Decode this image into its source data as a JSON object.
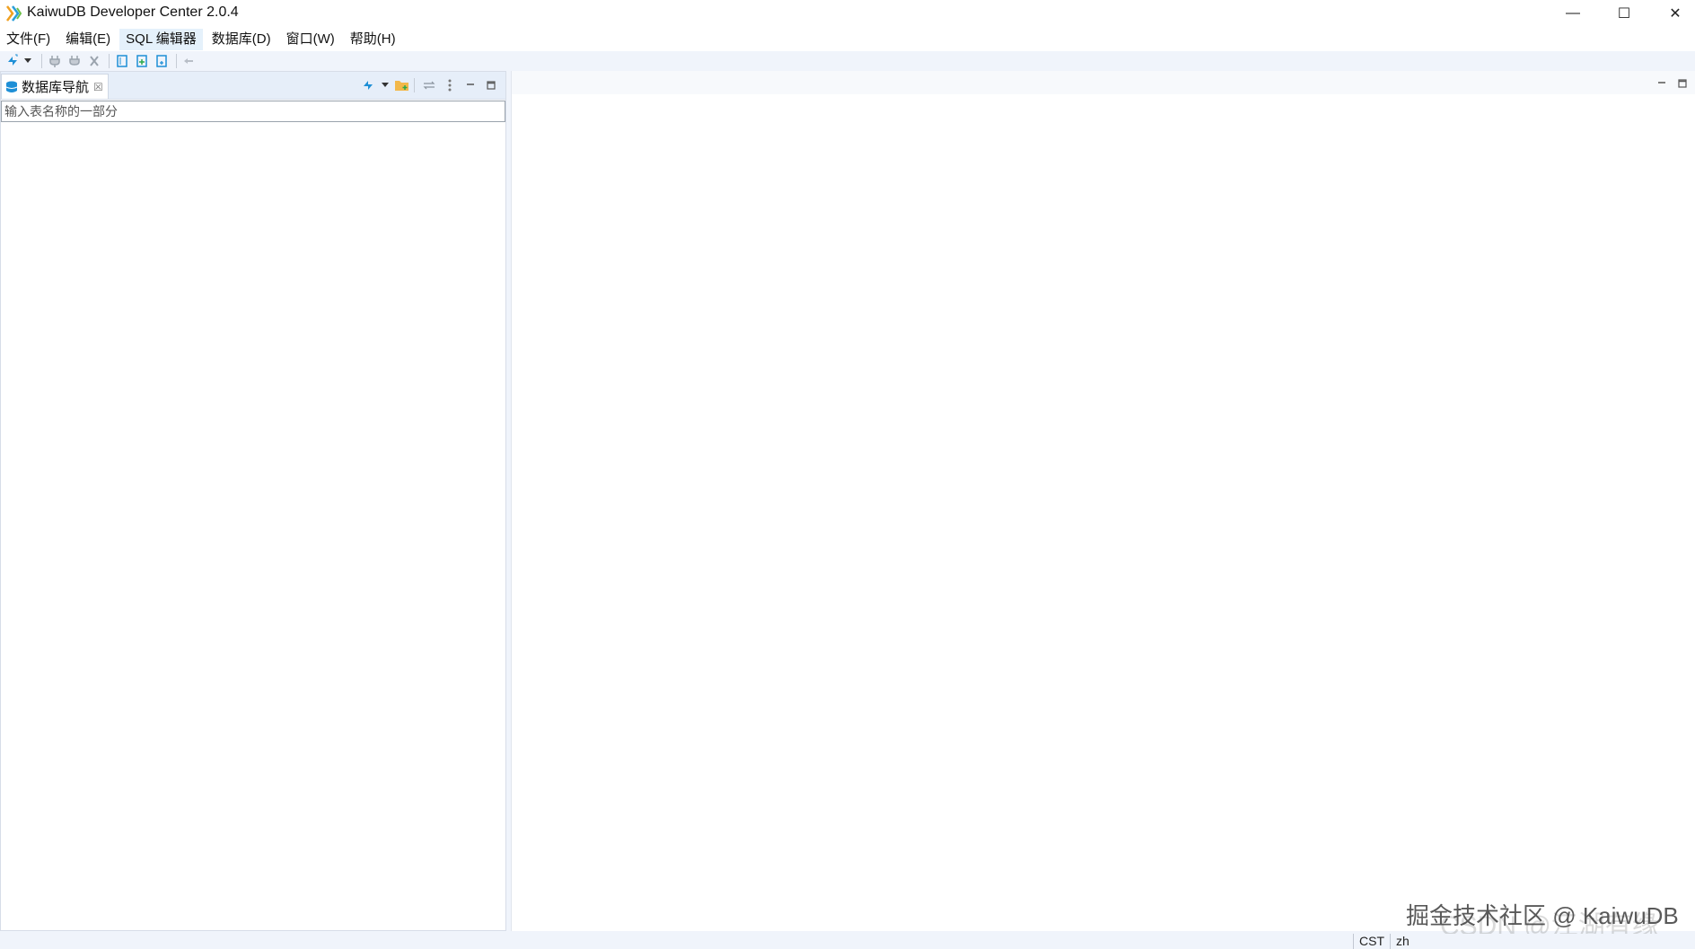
{
  "window": {
    "title": "KaiwuDB Developer Center 2.0.4",
    "controls": {
      "minimize": "—",
      "maximize": "☐",
      "close": "✕"
    }
  },
  "menu": {
    "items": [
      "文件(F)",
      "编辑(E)",
      "SQL 编辑器",
      "数据库(D)",
      "窗口(W)",
      "帮助(H)"
    ],
    "active": "SQL 编辑器"
  },
  "toolbar": {
    "icons": [
      "new-connection-icon",
      "dropdown-arrow-icon",
      "connect-icon",
      "reconnect-icon",
      "disconnect-icon",
      "sql-editor-icon",
      "new-script-icon",
      "recent-script-icon",
      "commit-mode-icon"
    ]
  },
  "navigator": {
    "tab_label": "数据库导航",
    "tab_close": "☒",
    "filter_placeholder": "输入表名称的一部分"
  },
  "statusbar": {
    "timezone": "CST",
    "locale": "zh"
  },
  "watermark": {
    "text": "掘金技术社区 @ KaiwuDB",
    "shadow_text": "CSDN @江湖有缘"
  },
  "colors": {
    "accent": "#1e8fd6",
    "toolbar_bg": "#f0f4fb",
    "panel_header_bg": "#e6eef9",
    "active_menu_bg": "#e5f1fb"
  }
}
